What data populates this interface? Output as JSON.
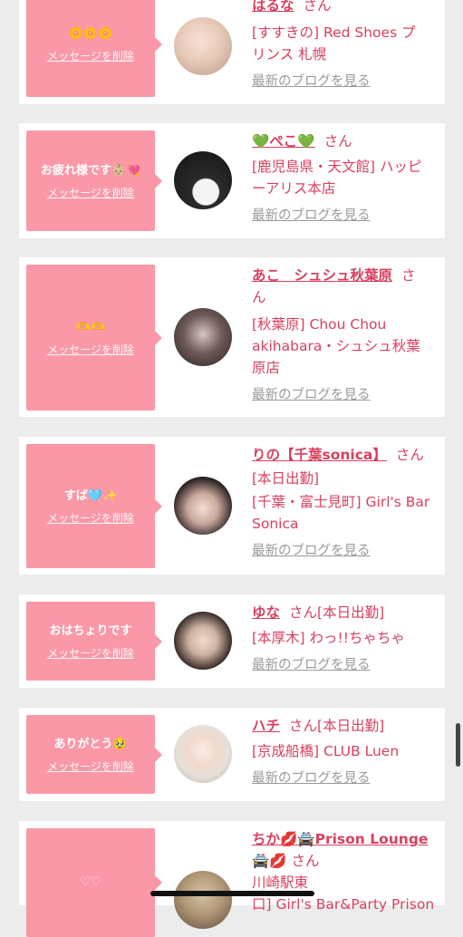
{
  "colors": {
    "accent": "#d9405f",
    "bubble": "#fa98a8",
    "muted": "#9a9a9a"
  },
  "san_label": "さん",
  "delete_label": "メッセージを削除",
  "blog_label": "最新のブログを見る",
  "cards": [
    {
      "message": "🌼🌼🌼",
      "name": "はるな",
      "lines": [
        "[すすきの] Red Shoes プ",
        "リンス 札幌"
      ]
    },
    {
      "message": "お疲れ様です👶🏼💘",
      "name": "💚ぺこ💚",
      "lines": [
        "[鹿児島県・天文館] ハッピ",
        "ーアリス本店"
      ]
    },
    {
      "message": "🫶🫶",
      "name": "あこ　シュシュ秋葉原",
      "name_extra": "さ",
      "lines": [
        "ん",
        "[秋葉原] Chou Chou",
        "akihabara・シュシュ秋葉",
        "原店"
      ]
    },
    {
      "message": "すば🩵✨",
      "name": "りの【千葉sonica】",
      "lines": [
        "[本日出勤]",
        "[千葉・富士見町] Girl's Bar",
        "Sonica"
      ]
    },
    {
      "message": "おはちょりです",
      "name": "ゆな",
      "san_suffix": "[本日出勤]",
      "lines": [
        "[本厚木] わっ!!ちゃちゃ"
      ]
    },
    {
      "message": "ありがとう🥹",
      "name": "ハチ",
      "san_suffix": "[本日出勤]",
      "lines": [
        "[京成船橋] CLUB Luen"
      ]
    },
    {
      "message": "♡♡",
      "name": "ちか💋🚔Prison Lounge",
      "lines": [
        "🚔💋 さん",
        "川崎駅東",
        "口] Girl's Bar&Party Prison"
      ]
    }
  ]
}
